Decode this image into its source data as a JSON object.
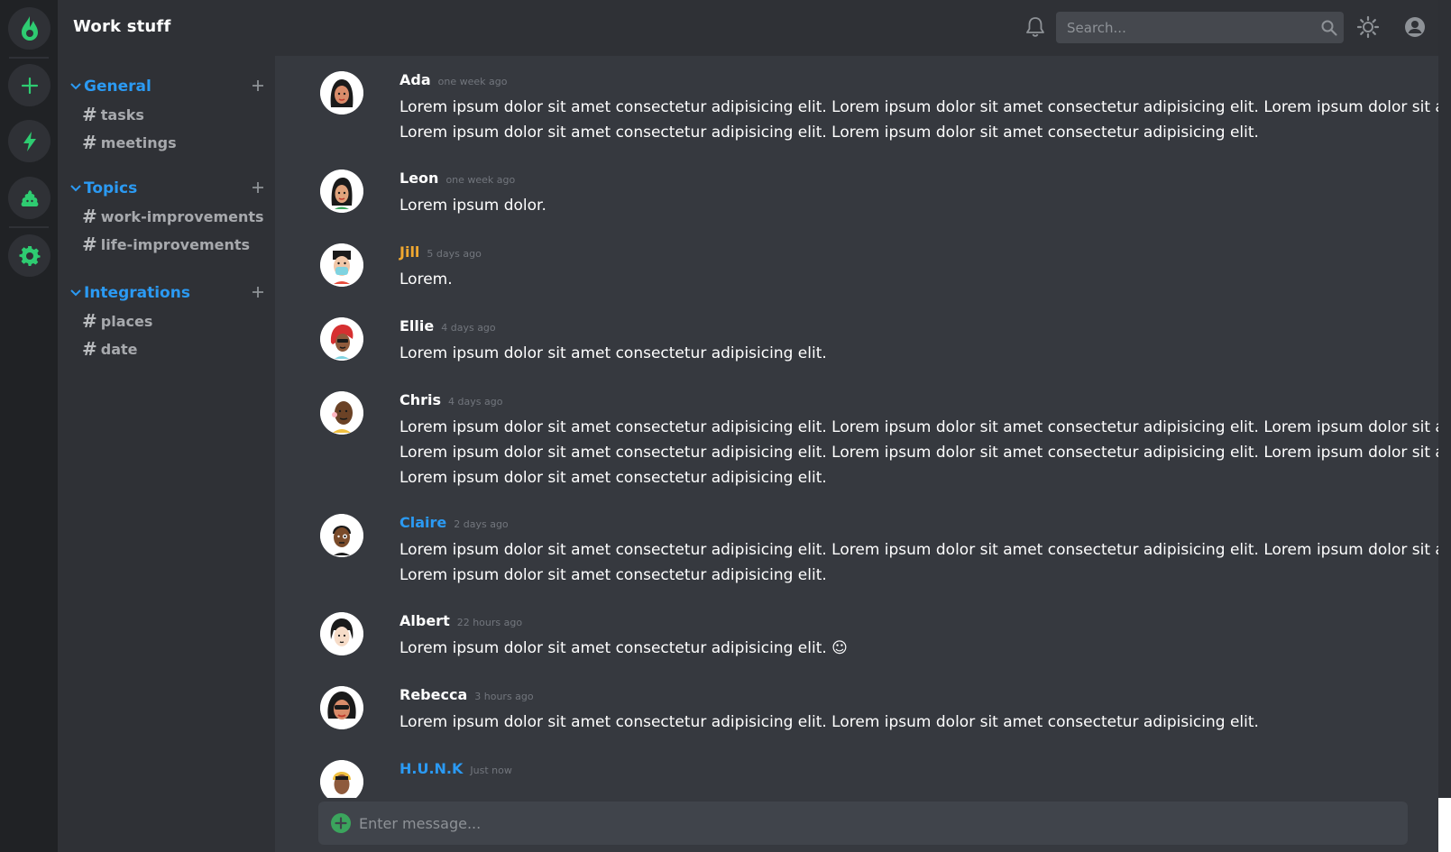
{
  "rail": {
    "items": [
      {
        "name": "home-logo-icon"
      },
      {
        "name": "add-server-icon"
      },
      {
        "name": "lightning-icon"
      },
      {
        "name": "poop-icon"
      },
      {
        "name": "settings-gear-icon"
      }
    ],
    "accent": "#2ecc71"
  },
  "sidebar": {
    "workspace_title": "Work stuff",
    "groups": [
      {
        "name": "General",
        "channels": [
          "tasks",
          "meetings"
        ]
      },
      {
        "name": "Topics",
        "channels": [
          "work-improvements",
          "life-improvements"
        ]
      },
      {
        "name": "Integrations",
        "channels": [
          "places",
          "date"
        ]
      }
    ],
    "hash": "#",
    "group_color": "#2b9af3"
  },
  "topbar": {
    "search_placeholder": "Search..."
  },
  "messages": [
    {
      "author": "Ada",
      "time": "one week ago",
      "color": "#ffffff",
      "lines": [
        "Lorem ipsum dolor sit amet consectetur adipisicing elit. Lorem ipsum dolor sit amet consectetur adipisicing elit. Lorem ipsum dolor sit amet co",
        "Lorem ipsum dolor sit amet consectetur adipisicing elit. Lorem ipsum dolor sit amet consectetur adipisicing elit."
      ]
    },
    {
      "author": "Leon",
      "time": "one week ago",
      "color": "#ffffff",
      "lines": [
        "Lorem ipsum dolor."
      ]
    },
    {
      "author": "Jill",
      "time": "5 days ago",
      "color": "#f0a830",
      "lines": [
        "Lorem."
      ]
    },
    {
      "author": "Ellie",
      "time": "4 days ago",
      "color": "#ffffff",
      "lines": [
        "Lorem ipsum dolor sit amet consectetur adipisicing elit."
      ]
    },
    {
      "author": "Chris",
      "time": "4 days ago",
      "color": "#ffffff",
      "lines": [
        "Lorem ipsum dolor sit amet consectetur adipisicing elit. Lorem ipsum dolor sit amet consectetur adipisicing elit. Lorem ipsum dolor sit amet co",
        "Lorem ipsum dolor sit amet consectetur adipisicing elit. Lorem ipsum dolor sit amet consectetur adipisicing elit. Lorem ipsum dolor sit amet co",
        "Lorem ipsum dolor sit amet consectetur adipisicing elit."
      ]
    },
    {
      "author": "Claire",
      "time": "2 days ago",
      "color": "#2b9af3",
      "lines": [
        "Lorem ipsum dolor sit amet consectetur adipisicing elit. Lorem ipsum dolor sit amet consectetur adipisicing elit. Lorem ipsum dolor sit amet co",
        "Lorem ipsum dolor sit amet consectetur adipisicing elit."
      ]
    },
    {
      "author": "Albert",
      "time": "22 hours ago",
      "color": "#ffffff",
      "lines": [
        "Lorem ipsum dolor sit amet consectetur adipisicing elit. ☺"
      ]
    },
    {
      "author": "Rebecca",
      "time": "3 hours ago",
      "color": "#ffffff",
      "lines": [
        "Lorem ipsum dolor sit amet consectetur adipisicing elit. Lorem ipsum dolor sit amet consectetur adipisicing elit."
      ]
    },
    {
      "author": "H.U.N.K",
      "time": "Just now",
      "color": "#2b9af3",
      "lines": []
    }
  ],
  "composer": {
    "placeholder": "Enter message..."
  }
}
